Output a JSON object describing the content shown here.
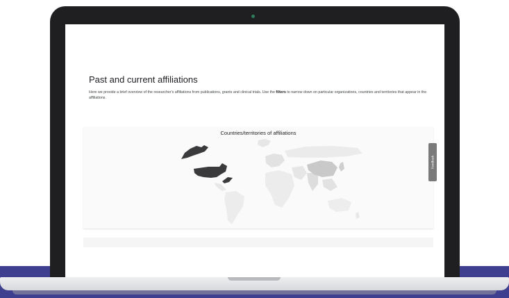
{
  "page": {
    "section_title": "Past and current affiliations",
    "intro_before_bold": "Here we provide a brief overview of the researcher's affiliations from publications, grants and clinical trials. Use the ",
    "intro_bold": "filters",
    "intro_after_bold": " to narrow down on particular organizations, countries and territories that appear in the affiliations."
  },
  "map_card": {
    "title": "Countries/territories of affiliations"
  },
  "feedback_tab": {
    "label": "Feedback"
  },
  "colors": {
    "brand_stripe": "#3e3f8f",
    "laptop_bezel": "#1f1f21",
    "map_highlight": "#3a3a3c",
    "map_light": "#e2e2e2",
    "map_mid": "#c9c9c9"
  }
}
